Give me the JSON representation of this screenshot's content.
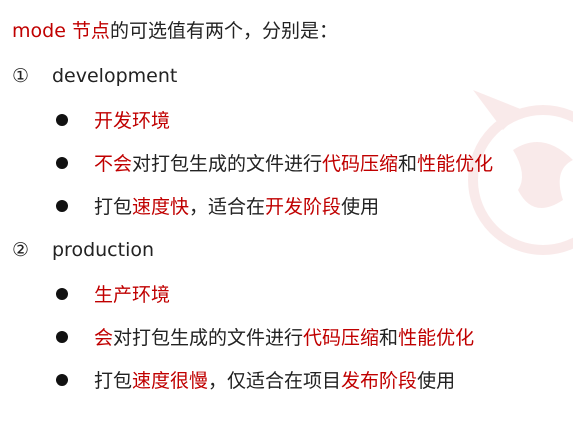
{
  "heading": {
    "part1": "mode 节点",
    "part2": "的可选值有两个，分别是："
  },
  "options": [
    {
      "marker": "①",
      "name": "development",
      "bullets": [
        {
          "segments": [
            {
              "text": "开发环境",
              "hl": true
            }
          ]
        },
        {
          "segments": [
            {
              "text": "不会",
              "hl": true
            },
            {
              "text": "对打包生成的文件进行",
              "hl": false
            },
            {
              "text": "代码压缩",
              "hl": true
            },
            {
              "text": "和",
              "hl": false
            },
            {
              "text": "性能优化",
              "hl": true
            }
          ]
        },
        {
          "segments": [
            {
              "text": "打包",
              "hl": false
            },
            {
              "text": "速度快",
              "hl": true
            },
            {
              "text": "，适合在",
              "hl": false
            },
            {
              "text": "开发阶段",
              "hl": true
            },
            {
              "text": "使用",
              "hl": false
            }
          ]
        }
      ]
    },
    {
      "marker": "②",
      "name": "production",
      "bullets": [
        {
          "segments": [
            {
              "text": "生产环境",
              "hl": true
            }
          ]
        },
        {
          "segments": [
            {
              "text": "会",
              "hl": true
            },
            {
              "text": "对打包生成的文件进行",
              "hl": false
            },
            {
              "text": "代码压缩",
              "hl": true
            },
            {
              "text": "和",
              "hl": false
            },
            {
              "text": "性能优化",
              "hl": true
            }
          ]
        },
        {
          "segments": [
            {
              "text": "打包",
              "hl": false
            },
            {
              "text": "速度很慢",
              "hl": true
            },
            {
              "text": "，仅适合在项目",
              "hl": false
            },
            {
              "text": "发布阶段",
              "hl": true
            },
            {
              "text": "使用",
              "hl": false
            }
          ]
        }
      ]
    }
  ],
  "colors": {
    "highlight": "#c00000",
    "text": "#222222",
    "bullet": "#111111"
  }
}
